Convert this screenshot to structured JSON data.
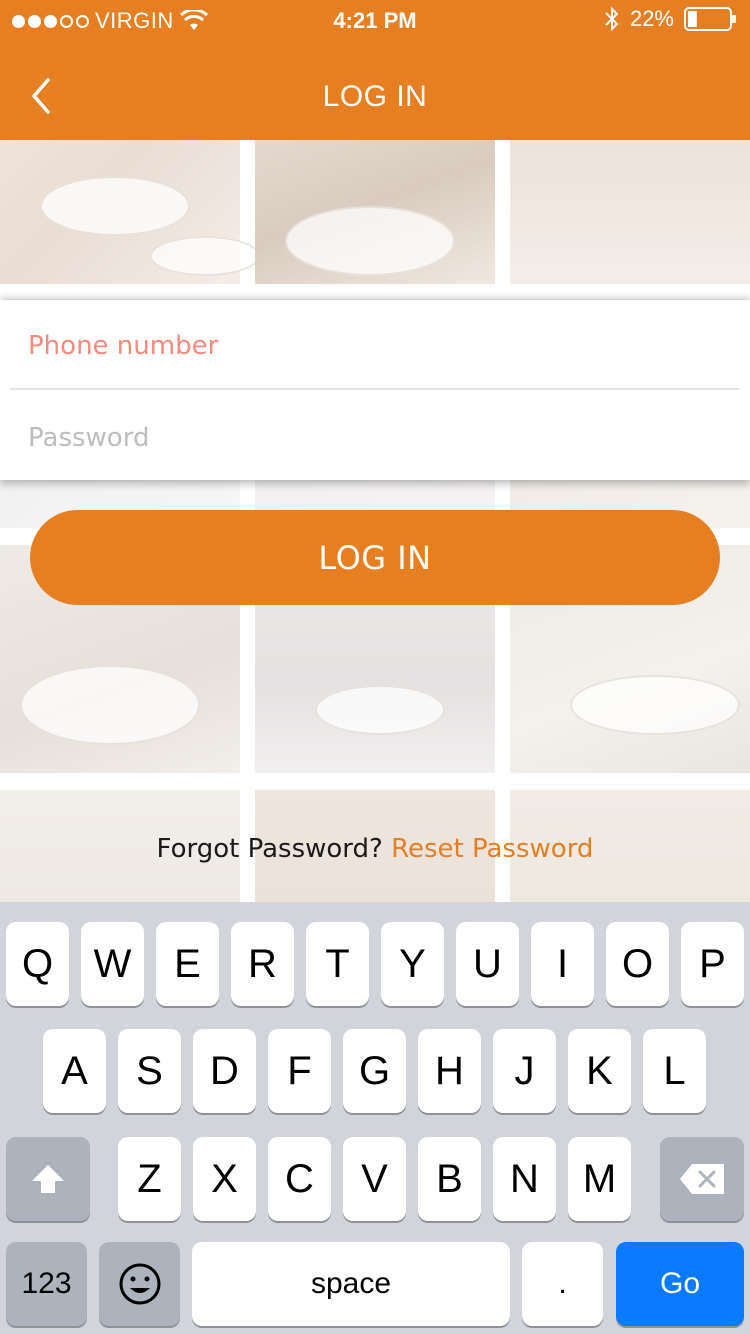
{
  "status_bar": {
    "carrier": "VIRGIN",
    "time": "4:21 PM",
    "battery": "22%",
    "signal_filled": 3,
    "signal_total": 5,
    "battery_level": 0.22
  },
  "nav": {
    "title": "LOG IN",
    "back_icon": "chevron-left-icon"
  },
  "form": {
    "phone_placeholder": "Phone number",
    "phone_value": "",
    "password_placeholder": "Password",
    "password_value": ""
  },
  "login_button": "LOG IN",
  "forgot": {
    "text": "Forgot Password?",
    "link": "Reset Password"
  },
  "keyboard": {
    "row1": [
      "Q",
      "W",
      "E",
      "R",
      "T",
      "Y",
      "U",
      "I",
      "O",
      "P"
    ],
    "row2": [
      "A",
      "S",
      "D",
      "F",
      "G",
      "H",
      "J",
      "K",
      "L"
    ],
    "row3": [
      "Z",
      "X",
      "C",
      "V",
      "B",
      "N",
      "M"
    ],
    "numbers_key": "123",
    "space_key": "space",
    "period_key": ".",
    "go_key": "Go",
    "shift_icon": "shift-icon",
    "backspace_icon": "backspace-icon",
    "emoji_icon": "emoji-icon"
  },
  "colors": {
    "brand": "#E67E22",
    "go_key": "#0A7AFF",
    "phone_placeholder": "#F28B80"
  }
}
